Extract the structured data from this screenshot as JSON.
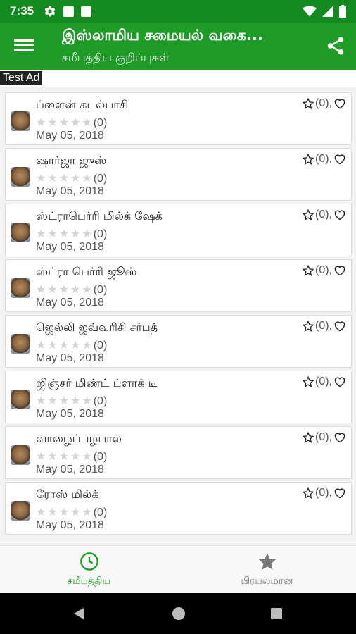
{
  "status_bar": {
    "time": "7:35"
  },
  "app_bar": {
    "title": "இஸ்லாமிய சமையல் வகை...",
    "subtitle": "சமீபத்திய குறிப்புகள்"
  },
  "ad": {
    "label": "Test Ad"
  },
  "items": [
    {
      "title": "ப்ளைன் கடல்பாசி",
      "rating_count": "(0)",
      "date": "May 05, 2018",
      "fav_count": "(0),"
    },
    {
      "title": "ஷார்ஜா ஜுஸ்",
      "rating_count": "(0)",
      "date": "May 05, 2018",
      "fav_count": "(0),"
    },
    {
      "title": "ஸ்ட்ராபெர்ரி மில்க் ஷேக்",
      "rating_count": "(0)",
      "date": "May 05, 2018",
      "fav_count": "(0),"
    },
    {
      "title": "ஸ்ட்ரா பெர்ரி ஜூஸ்",
      "rating_count": "(0)",
      "date": "May 05, 2018",
      "fav_count": "(0),"
    },
    {
      "title": "ஜெல்லி ஜவ்வரிசி சர்பத்",
      "rating_count": "(0)",
      "date": "May 05, 2018",
      "fav_count": "(0),"
    },
    {
      "title": "ஜிஞ்சர் மிண்ட் ப்ளாக் டீ",
      "rating_count": "(0)",
      "date": "May 05, 2018",
      "fav_count": "(0),"
    },
    {
      "title": "வாழைப்பழபால்",
      "rating_count": "(0)",
      "date": "May 05, 2018",
      "fav_count": "(0),"
    },
    {
      "title": "ரோஸ் மில்க்",
      "rating_count": "(0)",
      "date": "May 05, 2018",
      "fav_count": "(0),"
    }
  ],
  "bottom_nav": {
    "recent_label": "சமீபத்திய",
    "popular_label": "பிரபலமான"
  },
  "colors": {
    "primary": "#1e9c27",
    "primary_dark": "#128a1f",
    "active_nav": "#1e9c27",
    "inactive_nav": "#777777"
  }
}
